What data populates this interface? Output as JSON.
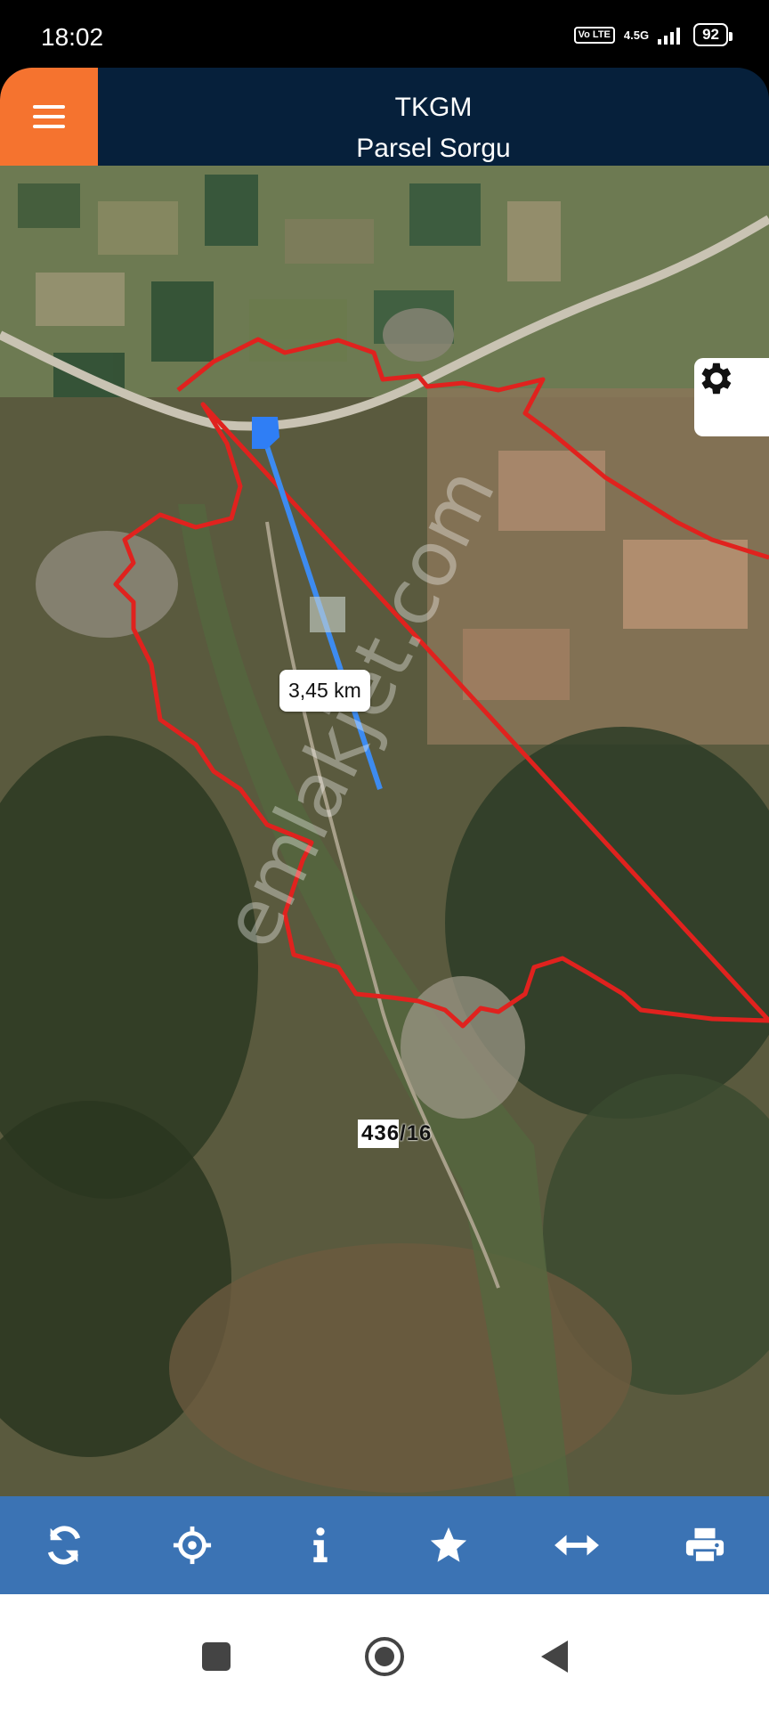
{
  "status_bar": {
    "time": "18:02",
    "volte": "Vo LTE",
    "network": "4.5G",
    "battery": "92"
  },
  "header": {
    "title": "TKGM",
    "subtitle": "Parsel Sorgu",
    "menu_icon": "hamburger-menu-icon",
    "colors": {
      "header_bg": "#06203b",
      "menu_bg": "#f5732f"
    }
  },
  "map": {
    "distance_label": "3,45 km",
    "parcel_label": "436/16",
    "watermark": "emlakjet.com",
    "settings_icon": "gear-icon",
    "colors": {
      "boundary": "#e0221e",
      "measure_line": "#3d8bf0"
    }
  },
  "toolbar": {
    "items": [
      {
        "name": "refresh",
        "icon": "refresh-icon"
      },
      {
        "name": "locate",
        "icon": "crosshair-icon"
      },
      {
        "name": "info",
        "icon": "info-icon"
      },
      {
        "name": "favorite",
        "icon": "star-icon"
      },
      {
        "name": "measure",
        "icon": "arrows-horizontal-icon"
      },
      {
        "name": "print",
        "icon": "printer-icon"
      }
    ],
    "color": "#3b73b4"
  },
  "nav_bar": {
    "items": [
      "recents",
      "home",
      "back"
    ]
  }
}
